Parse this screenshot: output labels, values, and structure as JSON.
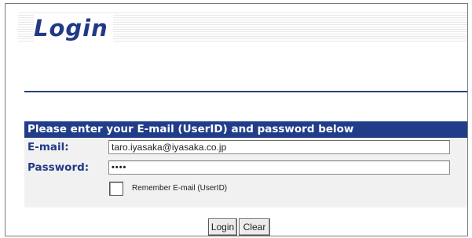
{
  "page": {
    "title": "Login"
  },
  "form": {
    "header": "Please enter your E-mail (UserID) and password below",
    "email_label": "E-mail:",
    "email_value": "taro.iyasaka@iyasaka.co.jp",
    "password_label": "Password:",
    "password_value": "••••",
    "remember_label": "Remember E-mail (UserID)",
    "remember_checked": false
  },
  "buttons": {
    "login_label": "Login",
    "clear_label": "Clear"
  },
  "colors": {
    "accent": "#213a85",
    "header_bg": "#213d8a",
    "form_bg": "#f1f1f1"
  }
}
